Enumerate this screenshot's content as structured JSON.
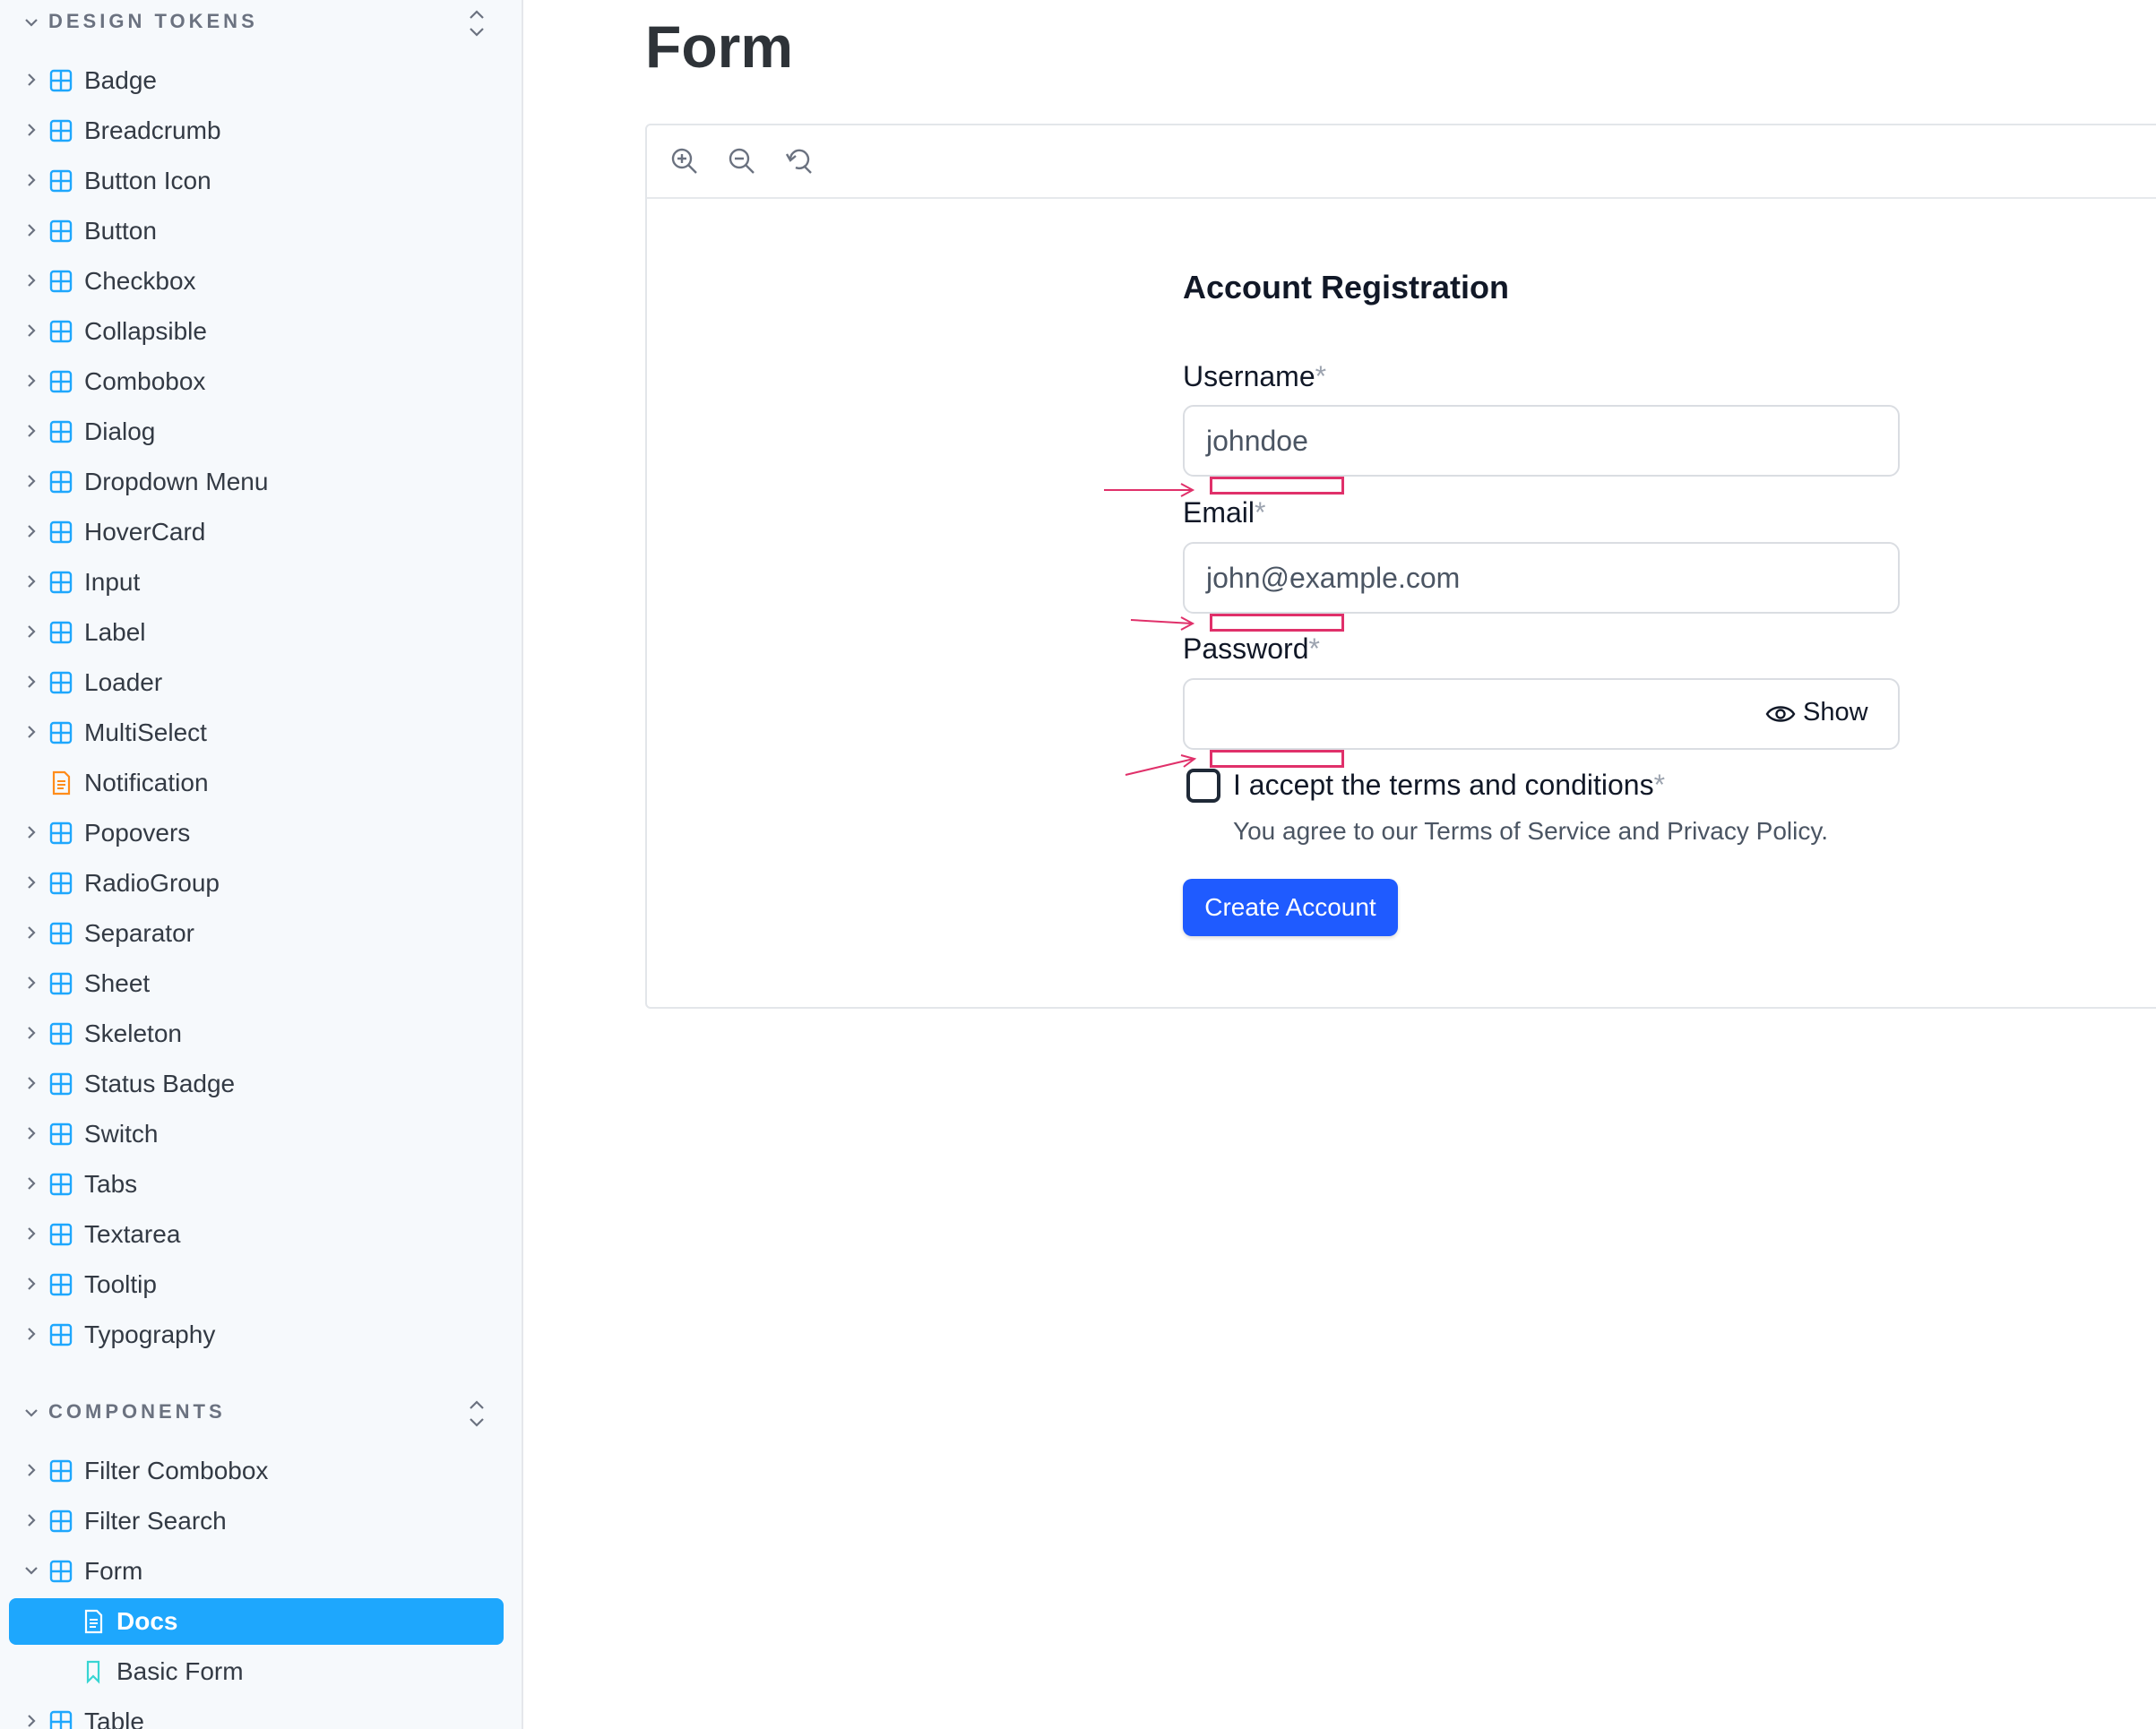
{
  "sidebar": {
    "design_tokens": {
      "title": "DESIGN TOKENS",
      "items": [
        "Badge",
        "Breadcrumb",
        "Button Icon",
        "Button",
        "Checkbox",
        "Collapsible",
        "Combobox",
        "Dialog",
        "Dropdown Menu",
        "HoverCard",
        "Input",
        "Label",
        "Loader",
        "MultiSelect",
        "Notification",
        "Popovers",
        "RadioGroup",
        "Separator",
        "Sheet",
        "Skeleton",
        "Status Badge",
        "Switch",
        "Tabs",
        "Textarea",
        "Tooltip",
        "Typography"
      ]
    },
    "components": {
      "title": "COMPONENTS",
      "items": [
        "Filter Combobox",
        "Filter Search",
        "Form"
      ],
      "form_children": [
        "Docs",
        "Basic Form"
      ],
      "after": [
        "Table"
      ]
    }
  },
  "page": {
    "title": "Form"
  },
  "form": {
    "title": "Account Registration",
    "username": {
      "label": "Username",
      "value": "johndoe"
    },
    "email": {
      "label": "Email",
      "value": "john@example.com"
    },
    "password": {
      "label": "Password",
      "value": "",
      "toggle_label": "Show"
    },
    "terms": {
      "label": "I accept the terms and conditions",
      "description": "You agree to our Terms of Service and Privacy Policy."
    },
    "required_mark": "*",
    "submit_label": "Create Account"
  },
  "colors": {
    "accent": "#1ea7fd",
    "primary_button": "#1f5bff",
    "error": "#e0306a",
    "component_icon": "#1ea7fd",
    "doc_icon": "#ff8c1a"
  }
}
